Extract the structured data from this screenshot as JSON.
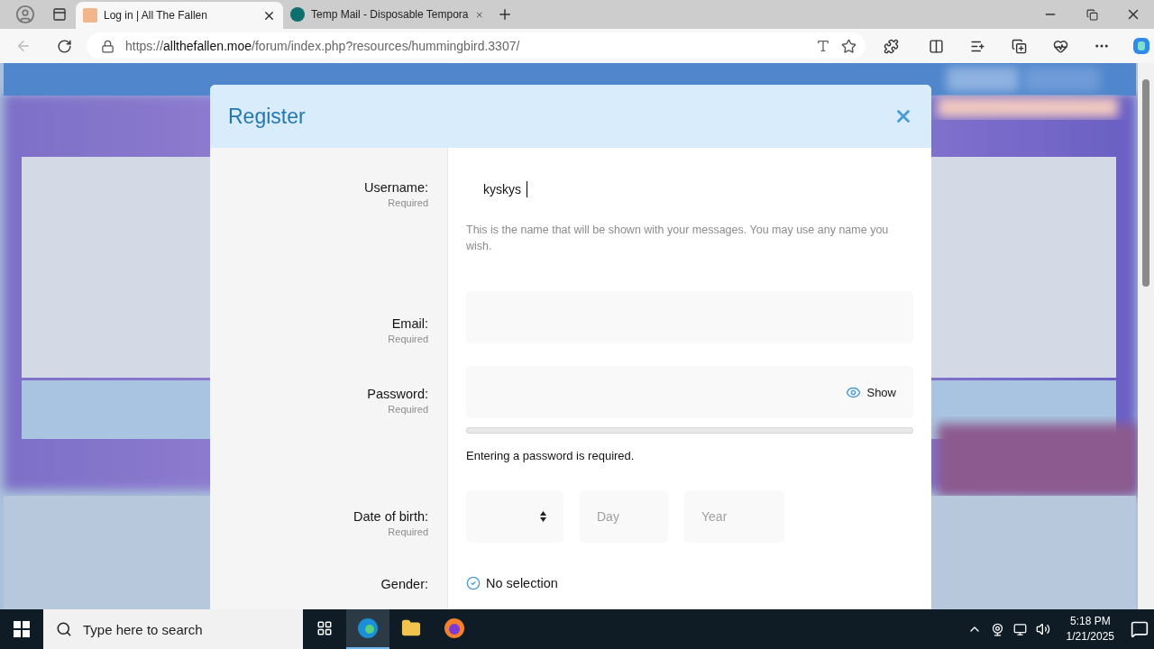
{
  "browser": {
    "tabs": [
      {
        "title": "Log in | All The Fallen",
        "selected": true
      },
      {
        "title": "Temp Mail - Disposable Tempora",
        "selected": false
      }
    ],
    "address": {
      "scheme": "https://",
      "host": "allthefallen.moe",
      "path": "/forum/index.php?resources/hummingbird.3307/"
    }
  },
  "dialog": {
    "title": "Register",
    "fields": [
      {
        "kind": "text",
        "label": "Username:",
        "note": "Required",
        "value": "kyskys",
        "hint": "This is the name that will be shown with your messages. You may use any name you wish."
      },
      {
        "kind": "email",
        "label": "Email:",
        "note": "Required"
      },
      {
        "kind": "password",
        "label": "Password:",
        "note": "Required",
        "toggle": "Show",
        "message": "Entering a password is required."
      },
      {
        "kind": "date",
        "label": "Date of birth:",
        "note": "Required",
        "day": "Day",
        "year": "Year"
      },
      {
        "kind": "radio",
        "label": "Gender:",
        "option": "No selection",
        "checked": true
      }
    ]
  },
  "taskbar": {
    "search": {
      "placeholder": "Type here to search"
    },
    "apps": [
      {
        "kind": "taskview",
        "selected": false
      },
      {
        "kind": "edge",
        "selected": true
      },
      {
        "kind": "folder",
        "selected": false
      },
      {
        "kind": "firefox",
        "selected": false
      }
    ],
    "time": "5:18 PM",
    "date": "1/21/2025"
  }
}
